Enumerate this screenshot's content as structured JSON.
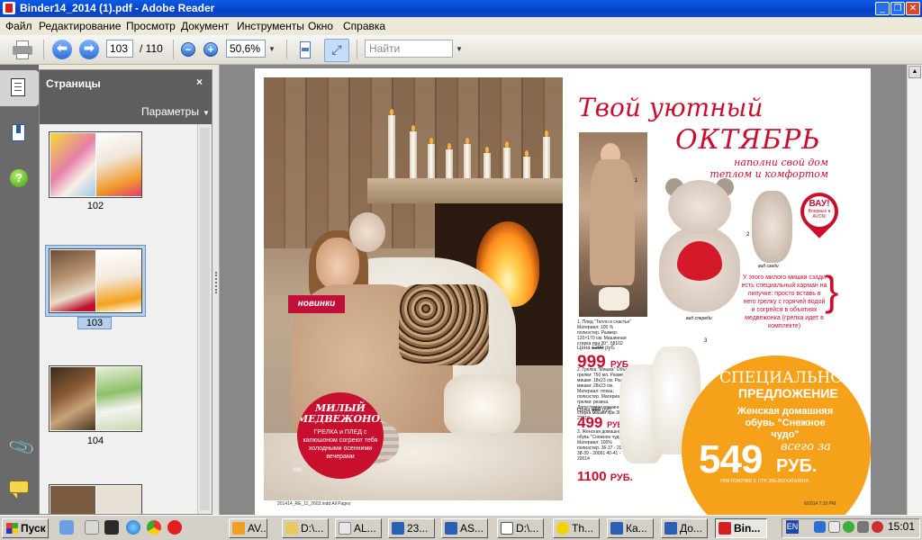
{
  "window": {
    "title": "Binder14_2014 (1).pdf - Adobe Reader",
    "minimize": "_",
    "restore": "❐",
    "close": "✕"
  },
  "menu": [
    "Файл",
    "Редактирование",
    "Просмотр",
    "Документ",
    "Инструменты",
    "Окно",
    "Справка"
  ],
  "toolbar": {
    "page_current": "103",
    "page_total": "/ 110",
    "zoom": "50,6%",
    "search_placeholder": "Найти"
  },
  "pages_panel": {
    "title": "Страницы",
    "close": "×",
    "options": "Параметры",
    "thumbnails": [
      {
        "label": "102",
        "selected": false
      },
      {
        "label": "103",
        "selected": true
      },
      {
        "label": "104",
        "selected": false
      }
    ]
  },
  "magazine": {
    "headline_line1": "Твой уютный",
    "headline_line2": "ОКТЯБРЬ",
    "subhead": "наполни свой дом теплом и комфортом",
    "novinki": "новинки",
    "bear_badge_title": "МИЛЫЙ МЕДВЕЖОНОК-",
    "bear_badge_text": "ГРЕЛКА и ПЛЕД с капюшоном согреют тебя холодными осенними вечерами",
    "page_number_left": "266",
    "wow_big": "ВАУ!",
    "wow_small": "Впервые в AVON!",
    "pocket_note": "У этого милого мишки сзади есть специальный карман на липучке: просто вставь в него грелку с горячей водой и согрейся в объятиях медвежонка (грелка идет в комплекте)",
    "cap_front": "вид спереди",
    "cap_back": "вид сзади",
    "num1": "1",
    "num2": "2",
    "num3": "3",
    "desc1": "1. Плед \"Тепло и счастье\" Материал: 100 % полиэстер. Размер: 120×170 см. Машинная стирка при 30°. 58102",
    "old1_label": "Цена",
    "old1": "1299",
    "old1_unit": "руб.",
    "price1": "999",
    "price1_unit": "РУБ.",
    "desc2": "2. Грелка \"Мишка\" Объем грелки: 750 мл. Размер мишки: 18x23 см. Размер мишки: 28x23 см. Материал: плюш, полиэстер. Материал грелки: резина. Допустимая машинная стирка мишки при 30°. 23816",
    "old2_label": "Цена",
    "old2": "650",
    "old2_unit": "руб.",
    "price2": "499",
    "price2_unit": "РУБ.",
    "desc3": "3. Женская домашняя обувь \"Снежное чудо\" Материал: 100% полиэстер. 36-37 - 20060 38-39 - 20061 40-41 - 20014",
    "price3": "1100",
    "price3_unit": "РУБ.",
    "special_line1": "СПЕЦИАЛЬНОЕ",
    "special_line2": "ПРЕДЛОЖЕНИЕ",
    "shoe_text": "Женская домашняя обувь \"Снежное чудо\"",
    "big_price": "549",
    "big_price_prefix": "всего за",
    "big_price_unit": "РУБ.",
    "catalog_note": "ПРИ ПОКУПКЕ С СТР. 256-263 КАТАЛОГА",
    "footer_left": "201414_RE_11_2603.indd  All Pages",
    "footer_right": "6/2014   7:10 PM"
  },
  "taskbar": {
    "start": "Пуск",
    "tasks": [
      {
        "label": "AV...",
        "color": "#f0a020"
      },
      {
        "label": "D:\\...",
        "color": "#e8c860"
      },
      {
        "label": "AL...",
        "color": "#e8e8e8"
      },
      {
        "label": "23...",
        "color": "#2b5fb3"
      },
      {
        "label": "AS...",
        "color": "#2b5fb3"
      },
      {
        "label": "D:\\...",
        "color": "#ffffff"
      },
      {
        "label": "Th...",
        "color": "#f2d200"
      },
      {
        "label": "Ка...",
        "color": "#2b5fb3"
      },
      {
        "label": "До...",
        "color": "#2b5fb3"
      },
      {
        "label": "Bin...",
        "color": "#d42020",
        "active": true
      }
    ],
    "lang": "EN",
    "clock": "15:01"
  }
}
